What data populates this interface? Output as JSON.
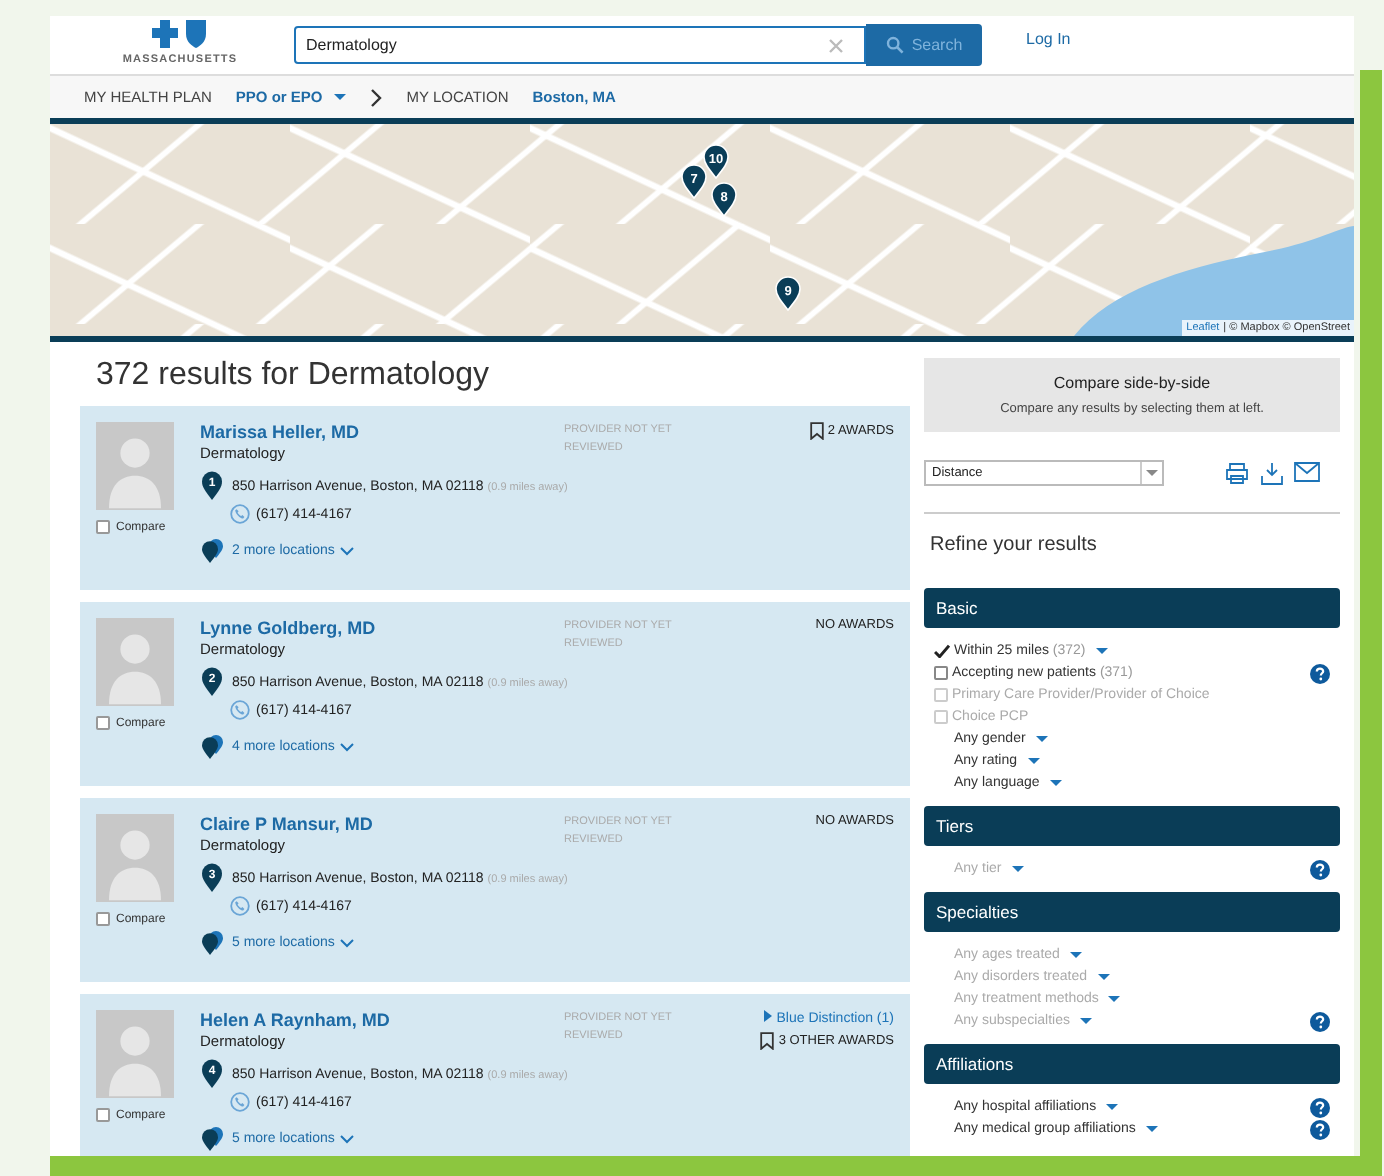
{
  "header": {
    "logo_text": "MASSACHUSETTS",
    "search": {
      "value": "Dermatology"
    },
    "search_button": "Search",
    "login": "Log In"
  },
  "nav": {
    "plan_label": "MY HEALTH PLAN",
    "plan_value": "PPO or EPO",
    "location_label": "MY LOCATION",
    "location_value": "Boston, MA"
  },
  "map": {
    "markers": [
      {
        "number": "10"
      },
      {
        "number": "7"
      },
      {
        "number": "8"
      },
      {
        "number": "9"
      }
    ],
    "attribution_link": "Leaflet",
    "attribution_text": "| © Mapbox © OpenStreet"
  },
  "results_title": "372 results for Dermatology",
  "providers": [
    {
      "name": "Marissa Heller, MD",
      "specialty": "Dermatology",
      "pin": "1",
      "address": "850 Harrison Avenue, Boston, MA 02118",
      "distance": "(0.9 miles away)",
      "phone": "(617) 414-4167",
      "more_locations": "2 more locations",
      "review": "PROVIDER NOT YET REVIEWED",
      "compare_label": "Compare",
      "compare_checked": false,
      "awards": [
        {
          "kind": "bookmark",
          "text": "2 AWARDS"
        }
      ]
    },
    {
      "name": "Lynne Goldberg, MD",
      "specialty": "Dermatology",
      "pin": "2",
      "address": "850 Harrison Avenue, Boston, MA 02118",
      "distance": "(0.9 miles away)",
      "phone": "(617) 414-4167",
      "more_locations": "4 more locations",
      "review": "PROVIDER NOT YET REVIEWED",
      "compare_label": "Compare",
      "compare_checked": false,
      "awards": [
        {
          "kind": "plain",
          "text": "NO AWARDS"
        }
      ]
    },
    {
      "name": "Claire P Mansur, MD",
      "specialty": "Dermatology",
      "pin": "3",
      "address": "850 Harrison Avenue, Boston, MA 02118",
      "distance": "(0.9 miles away)",
      "phone": "(617) 414-4167",
      "more_locations": "5 more locations",
      "review": "PROVIDER NOT YET REVIEWED",
      "compare_label": "Compare",
      "compare_checked": false,
      "awards": [
        {
          "kind": "plain",
          "text": "NO AWARDS"
        }
      ]
    },
    {
      "name": "Helen A Raynham, MD",
      "specialty": "Dermatology",
      "pin": "4",
      "address": "850 Harrison Avenue, Boston, MA 02118",
      "distance": "(0.9 miles away)",
      "phone": "(617) 414-4167",
      "more_locations": "5 more locations",
      "review": "PROVIDER NOT YET REVIEWED",
      "compare_label": "Compare",
      "compare_checked": false,
      "awards": [
        {
          "kind": "link",
          "text": "Blue Distinction (1)"
        },
        {
          "kind": "bookmark",
          "text": "3 OTHER AWARDS"
        }
      ]
    }
  ],
  "sidebar": {
    "compare_title": "Compare side-by-side",
    "compare_hint": "Compare any results by selecting them at left.",
    "sort": {
      "value": "Distance"
    },
    "refine_title": "Refine your results",
    "sections": [
      {
        "title": "Basic",
        "items": [
          {
            "kind": "checkbox",
            "label": "Within 25 miles",
            "count": "(372)",
            "checked": true,
            "disabled": false,
            "dropdown": true,
            "help": false
          },
          {
            "kind": "checkbox",
            "label": "Accepting new patients",
            "count": "(371)",
            "checked": false,
            "disabled": false,
            "dropdown": false,
            "help": true
          },
          {
            "kind": "checkbox",
            "label": "Primary Care Provider/Provider of Choice",
            "checked": false,
            "disabled": true,
            "dropdown": false,
            "help": false
          },
          {
            "kind": "checkbox",
            "label": "Choice PCP",
            "checked": false,
            "disabled": true,
            "dropdown": false,
            "help": false
          },
          {
            "kind": "dropdown",
            "label": "Any gender",
            "disabled": false,
            "help": false
          },
          {
            "kind": "dropdown",
            "label": "Any rating",
            "disabled": false,
            "help": false
          },
          {
            "kind": "dropdown",
            "label": "Any language",
            "disabled": false,
            "help": false
          }
        ]
      },
      {
        "title": "Tiers",
        "items": [
          {
            "kind": "dropdown",
            "label": "Any tier",
            "disabled": true,
            "help": true
          }
        ]
      },
      {
        "title": "Specialties",
        "items": [
          {
            "kind": "dropdown",
            "label": "Any ages treated",
            "disabled": true,
            "help": false
          },
          {
            "kind": "dropdown",
            "label": "Any disorders treated",
            "disabled": true,
            "help": false
          },
          {
            "kind": "dropdown",
            "label": "Any treatment methods",
            "disabled": true,
            "help": false
          },
          {
            "kind": "dropdown",
            "label": "Any subspecialties",
            "disabled": true,
            "help": true
          }
        ]
      },
      {
        "title": "Affiliations",
        "items": [
          {
            "kind": "dropdown",
            "label": "Any hospital affiliations",
            "disabled": false,
            "help": true
          },
          {
            "kind": "dropdown",
            "label": "Any medical group affiliations",
            "disabled": false,
            "help": true
          }
        ]
      }
    ]
  }
}
